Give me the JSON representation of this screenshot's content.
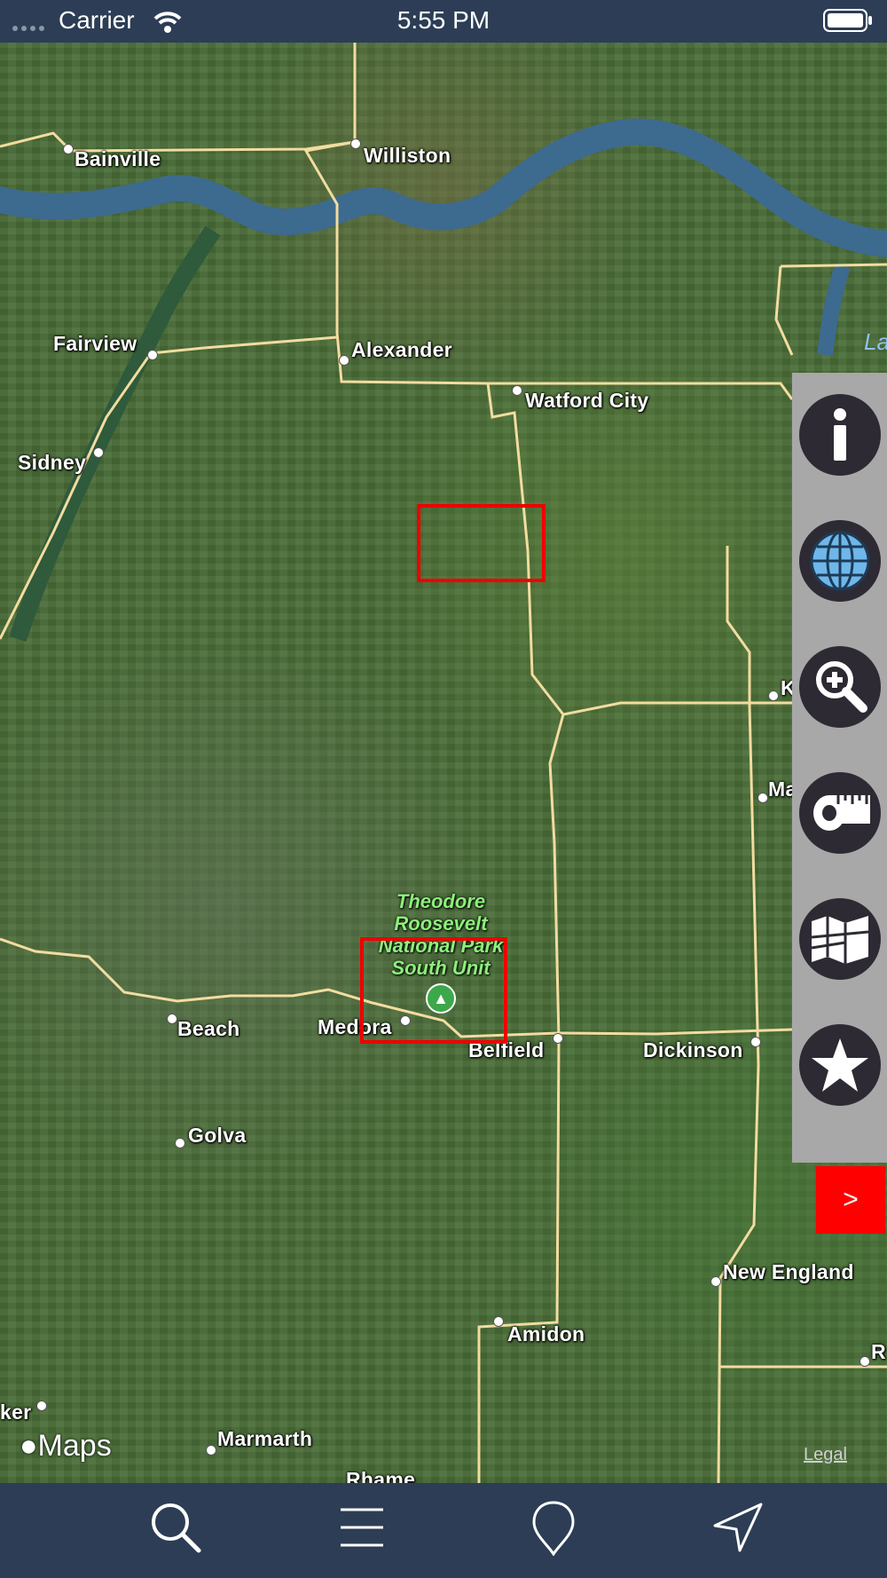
{
  "status_bar": {
    "carrier": "Carrier",
    "time": "5:55 PM"
  },
  "map": {
    "attribution": "Maps",
    "legal": "Legal",
    "lake_label": "La",
    "places": [
      "Bainville",
      "Williston",
      "Fairview",
      "Alexander",
      "Watford City",
      "Sidney",
      "K",
      "Ma",
      "Beach",
      "Medora",
      "Belfield",
      "Dickinson",
      "Golva",
      "New England",
      "Amidon",
      "R",
      "ker",
      "Marmarth",
      "Rhame"
    ],
    "park": {
      "line1": "Theodore",
      "line2": "Roosevelt",
      "line3": "National Park",
      "line4": "South Unit",
      "icon": "tree-icon"
    }
  },
  "tools": [
    {
      "icon": "info-icon"
    },
    {
      "icon": "globe-icon"
    },
    {
      "icon": "zoom-in-icon"
    },
    {
      "icon": "measuring-tape-icon"
    },
    {
      "icon": "folded-map-icon"
    },
    {
      "icon": "star-icon"
    }
  ],
  "panel_toggle": ">",
  "tab_bar": [
    {
      "icon": "search-icon"
    },
    {
      "icon": "menu-icon"
    },
    {
      "icon": "location-pin-icon"
    },
    {
      "icon": "navigation-arrow-icon"
    }
  ],
  "colors": {
    "bar_background": "#2c3d55",
    "panel_background": "#a8a8a8",
    "tool_button": "#2e2a33",
    "highlight_box": "#ee0000",
    "road": "#f2dca0",
    "river": "#3d6a8f"
  }
}
